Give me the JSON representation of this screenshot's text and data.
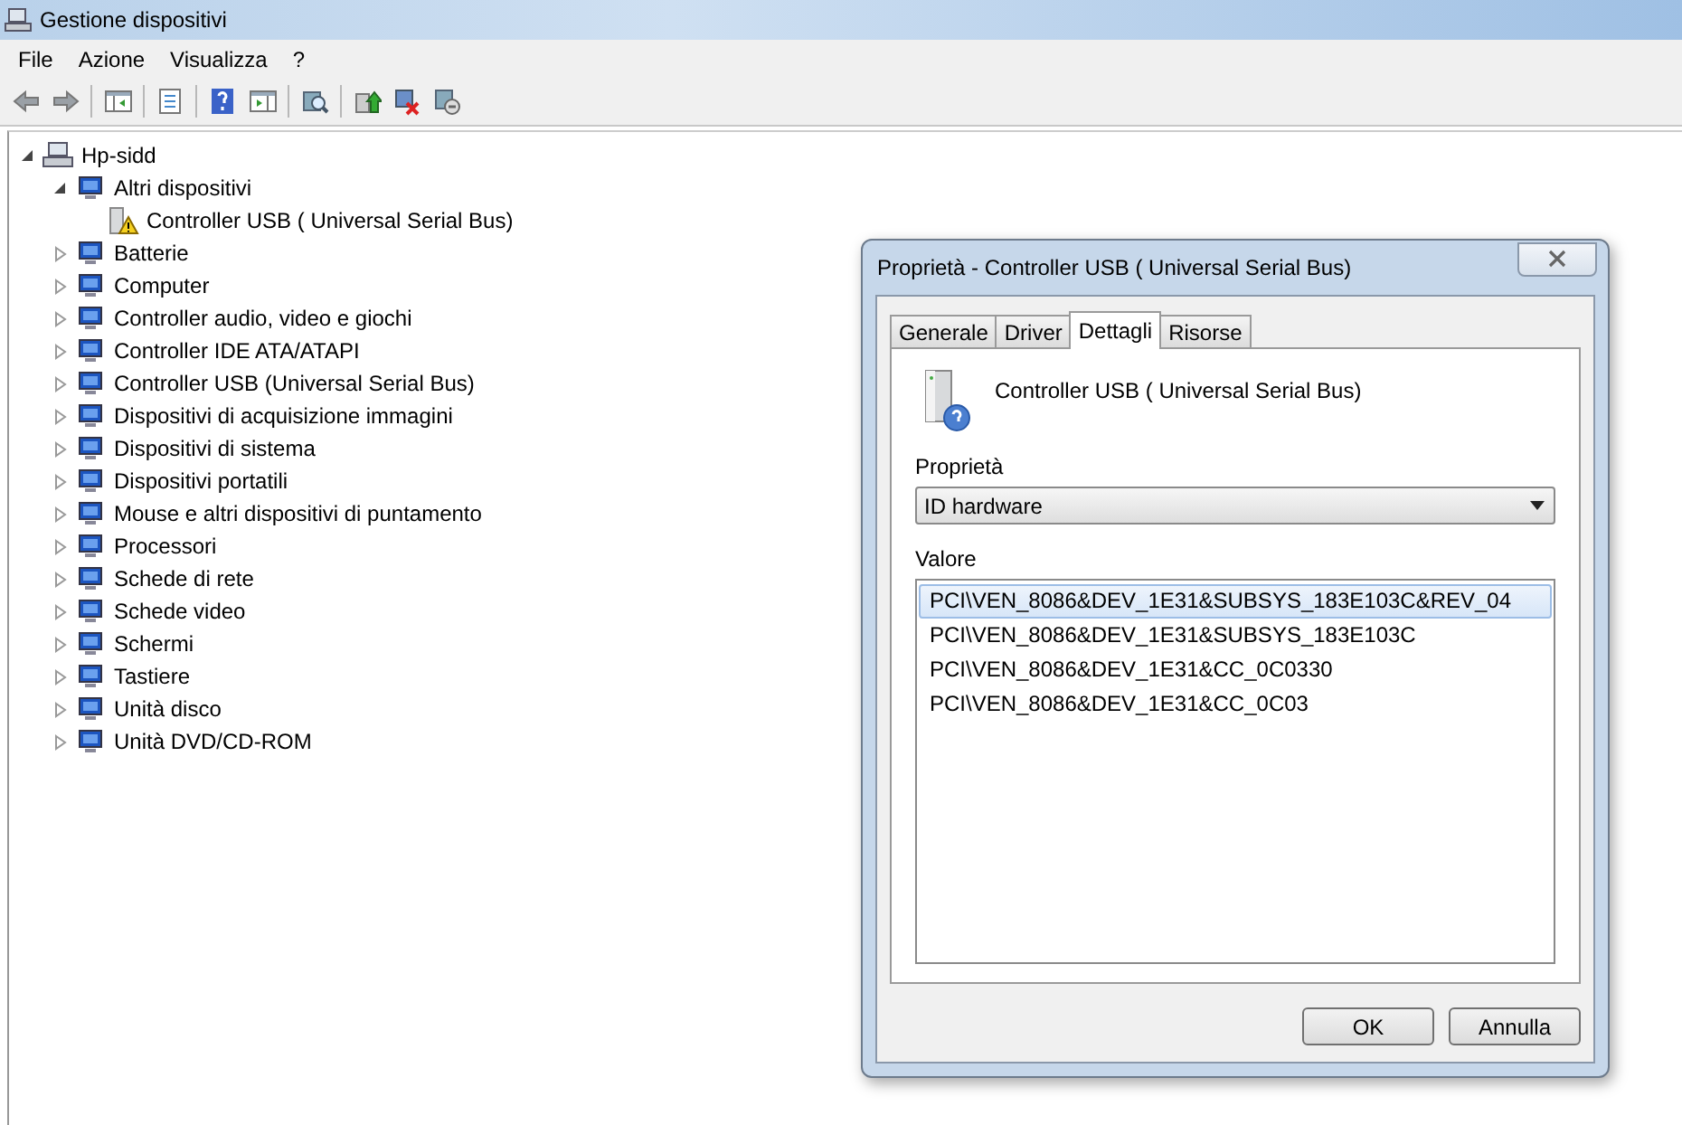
{
  "window": {
    "title": "Gestione dispositivi"
  },
  "menu": [
    "File",
    "Azione",
    "Visualizza",
    "?"
  ],
  "tree": [
    {
      "label": "Hp-sidd",
      "expanded": true,
      "children": [
        {
          "label": "Altri dispositivi",
          "expanded": true,
          "children": [
            {
              "label": "Controller USB ( Universal Serial Bus)",
              "warning": true
            }
          ]
        },
        {
          "label": "Batterie",
          "expanded": false
        },
        {
          "label": "Computer",
          "expanded": false
        },
        {
          "label": "Controller audio, video e giochi",
          "expanded": false
        },
        {
          "label": "Controller IDE ATA/ATAPI",
          "expanded": false
        },
        {
          "label": "Controller USB (Universal Serial Bus)",
          "expanded": false
        },
        {
          "label": "Dispositivi di acquisizione immagini",
          "expanded": false
        },
        {
          "label": "Dispositivi di sistema",
          "expanded": false
        },
        {
          "label": "Dispositivi portatili",
          "expanded": false
        },
        {
          "label": "Mouse e altri dispositivi di puntamento",
          "expanded": false
        },
        {
          "label": "Processori",
          "expanded": false
        },
        {
          "label": "Schede di rete",
          "expanded": false
        },
        {
          "label": "Schede video",
          "expanded": false
        },
        {
          "label": "Schermi",
          "expanded": false
        },
        {
          "label": "Tastiere",
          "expanded": false
        },
        {
          "label": "Unità disco",
          "expanded": false
        },
        {
          "label": "Unità DVD/CD-ROM",
          "expanded": false
        }
      ]
    }
  ],
  "dialog": {
    "title": "Proprietà - Controller USB ( Universal Serial Bus)",
    "tabs": [
      {
        "label": "Generale",
        "selected": false
      },
      {
        "label": "Driver",
        "selected": false
      },
      {
        "label": "Dettagli",
        "selected": true
      },
      {
        "label": "Risorse",
        "selected": false
      }
    ],
    "device_name": "Controller USB ( Universal Serial Bus)",
    "property_label": "Proprietà",
    "property_value": "ID hardware",
    "value_label": "Valore",
    "values": [
      {
        "text": "PCI\\VEN_8086&DEV_1E31&SUBSYS_183E103C&REV_04",
        "selected": true
      },
      {
        "text": "PCI\\VEN_8086&DEV_1E31&SUBSYS_183E103C",
        "selected": false
      },
      {
        "text": "PCI\\VEN_8086&DEV_1E31&CC_0C0330",
        "selected": false
      },
      {
        "text": "PCI\\VEN_8086&DEV_1E31&CC_0C03",
        "selected": false
      }
    ],
    "buttons": [
      "OK",
      "Annulla"
    ]
  }
}
